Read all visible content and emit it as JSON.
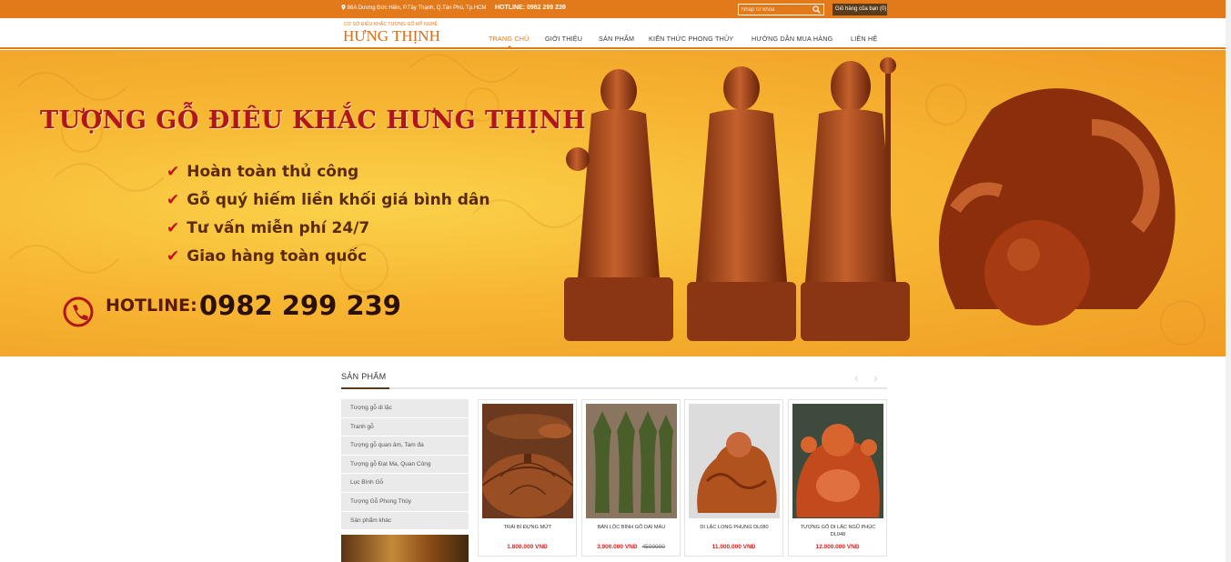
{
  "topbar": {
    "address": "86A Dương Đức Hiền, P.Tây Thạnh, Q.Tân Phú, Tp.HCM",
    "hotline": "HOTLINE: 0982 299 239",
    "search_placeholder": "Nhập từ khóa",
    "cart_label": "Giỏ hàng của bạn (0)"
  },
  "logo": {
    "subtitle": "CƠ SỞ ĐIÊU KHẮC TƯỢNG GỖ MỸ NGHỆ",
    "name": "HƯNG THỊNH"
  },
  "nav": {
    "items": [
      "TRANG CHỦ",
      "GIỚI THIỆU",
      "SẢN PHẨM",
      "KIẾN THỨC PHONG THỦY",
      "HƯỚNG DẪN MUA HÀNG",
      "LIÊN HỆ"
    ],
    "active_index": 0
  },
  "banner": {
    "title": "TƯỢNG GỖ ĐIÊU KHẮC HƯNG THỊNH",
    "features": [
      "Hoàn toàn thủ công",
      "Gỗ quý hiếm liền khối giá bình dân",
      "Tư vấn miễn phí 24/7",
      "Giao hàng toàn quốc"
    ],
    "hotline_label": "HOTLINE:",
    "hotline_number": "0982 299 239"
  },
  "products_section": {
    "title": "SẢN PHẨM",
    "prev_arrow": "‹",
    "next_arrow": "›"
  },
  "categories": [
    "Tượng gỗ di lặc",
    "Tranh gỗ",
    "Tượng gỗ quan âm, Tam đa",
    "Tượng gỗ Đạt Ma, Quan Công",
    "Lục Bình Gỗ",
    "Tượng Gỗ Phong Thủy",
    "Sản phẩm khác"
  ],
  "products": [
    {
      "name": "TRÁI BÍ ĐỰNG MỨT",
      "price": "1.800.000 VNĐ",
      "old_price": ""
    },
    {
      "name": "BÁN LỘC BÌNH GỖ DÁI MÀU",
      "price": "3.900.000 VNĐ",
      "old_price": "4500000"
    },
    {
      "name": "DI LẶC LONG PHỤNG DL080",
      "price": "11.000.000 VNĐ",
      "old_price": ""
    },
    {
      "name": "TƯỢNG GỖ DI LẶC NGŨ PHÚC DL048",
      "price": "12.000.000 VNĐ",
      "old_price": ""
    }
  ],
  "colors": {
    "accent": "#e27a1c",
    "dark_brown": "#5a3b1c",
    "price_red": "#e01b1b"
  }
}
